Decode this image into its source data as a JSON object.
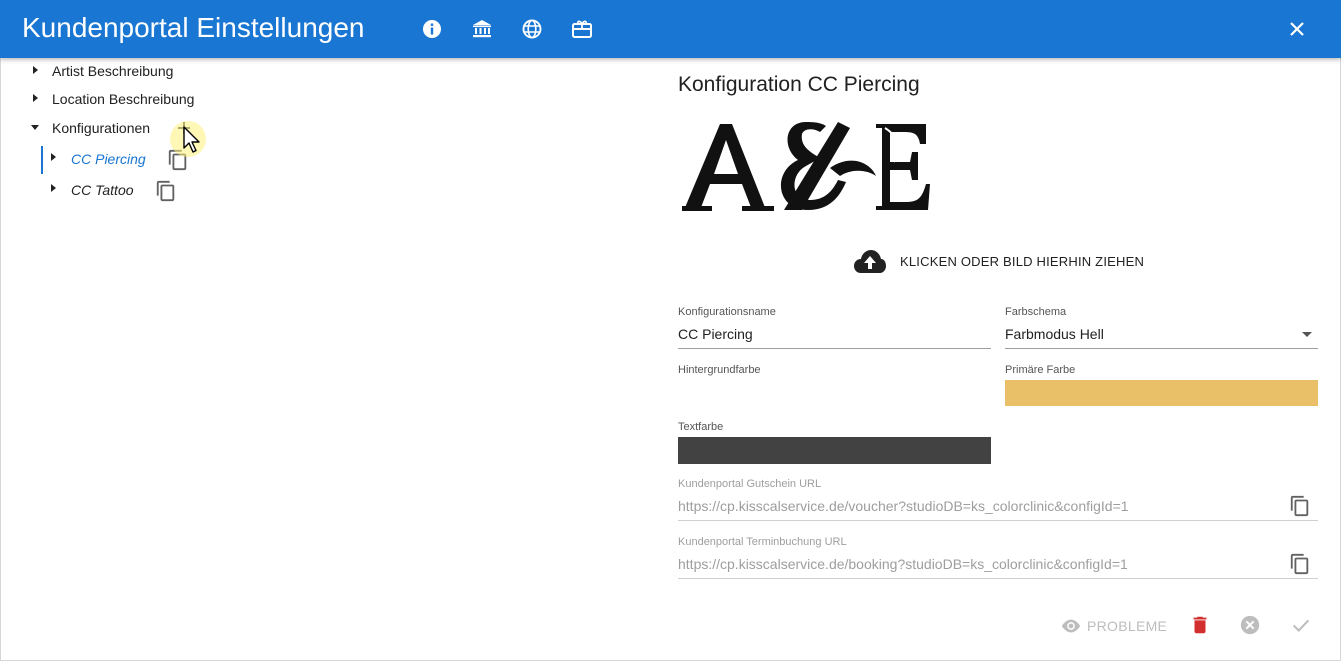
{
  "header": {
    "title": "Kundenportal Einstellungen",
    "icons": [
      "info-icon",
      "bank-icon",
      "globe-icon",
      "gift-card-icon"
    ],
    "close_icon": "close-icon"
  },
  "tree": {
    "items": [
      {
        "label": "Artist Beschreibung",
        "expanded": false
      },
      {
        "label": "Location Beschreibung",
        "expanded": false
      },
      {
        "label": "Konfigurationen",
        "expanded": true,
        "children": [
          {
            "label": "CC Piercing",
            "selected": true
          },
          {
            "label": "CC Tattoo",
            "selected": false
          }
        ]
      }
    ]
  },
  "panel": {
    "title": "Konfiguration CC Piercing",
    "logo_text": "A&E",
    "upload_label": "KLICKEN ODER BILD HIERHIN ZIEHEN",
    "fields": {
      "config_name": {
        "label": "Konfigurationsname",
        "value": "CC Piercing"
      },
      "color_scheme": {
        "label": "Farbschema",
        "value": "Farbmodus Hell"
      },
      "background_color": {
        "label": "Hintergrundfarbe",
        "value": "#ffffff"
      },
      "primary_color": {
        "label": "Primäre Farbe",
        "value": "#e9bf68"
      },
      "text_color": {
        "label": "Textfarbe",
        "value": "#424242"
      },
      "voucher_url": {
        "label": "Kundenportal Gutschein URL",
        "value": "https://cp.kisscalservice.de/voucher?studioDB=ks_colorclinic&configId=1"
      },
      "booking_url": {
        "label": "Kundenportal Terminbuchung URL",
        "value": "https://cp.kisscalservice.de/booking?studioDB=ks_colorclinic&configId=1"
      }
    },
    "actions": {
      "problems_label": "PROBLEME"
    }
  },
  "colors": {
    "accent": "#1976d2",
    "delete": "#d32f2f",
    "disabled": "#bdbdbd"
  }
}
